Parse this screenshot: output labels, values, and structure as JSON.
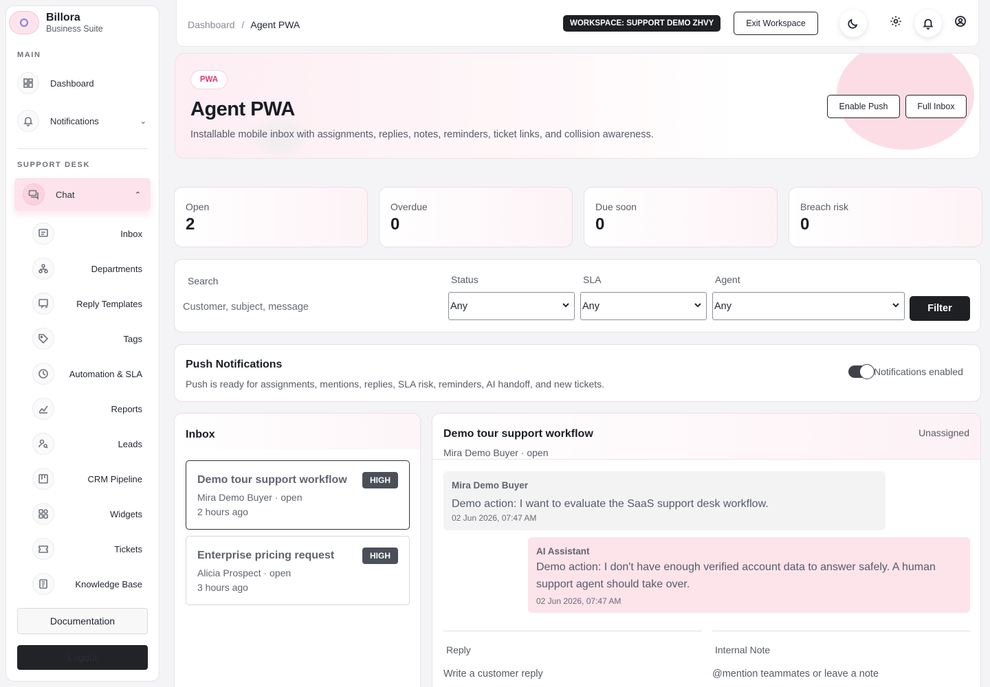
{
  "brand": {
    "name": "Billora",
    "subtitle": "Business Suite"
  },
  "sidebar": {
    "main_label": "MAIN",
    "support_label": "SUPPORT DESK",
    "dashboard": "Dashboard",
    "notifications": "Notifications",
    "chat": "Chat",
    "sub_items": [
      {
        "label": "Inbox",
        "icon": "message-icon"
      },
      {
        "label": "Departments",
        "icon": "org-icon"
      },
      {
        "label": "Reply Templates",
        "icon": "template-icon"
      },
      {
        "label": "Tags",
        "icon": "tag-icon"
      },
      {
        "label": "Automation & SLA",
        "icon": "clock-icon"
      },
      {
        "label": "Reports",
        "icon": "chart-icon"
      },
      {
        "label": "Leads",
        "icon": "user-search-icon"
      },
      {
        "label": "CRM Pipeline",
        "icon": "pipeline-icon"
      },
      {
        "label": "Widgets",
        "icon": "widgets-icon"
      },
      {
        "label": "Tickets",
        "icon": "ticket-icon"
      },
      {
        "label": "Knowledge Base",
        "icon": "book-icon"
      }
    ],
    "documentation": "Documentation",
    "logout": "Logout"
  },
  "topbar": {
    "breadcrumb_root": "Dashboard",
    "breadcrumb_sep": "/",
    "breadcrumb_current": "Agent PWA",
    "workspace_badge": "WORKSPACE: SUPPORT DEMO ZHVY",
    "exit_workspace": "Exit Workspace",
    "icons": [
      "moon-icon",
      "gear-icon",
      "bell-icon",
      "user-circle-icon"
    ]
  },
  "hero": {
    "pill": "PWA",
    "title": "Agent PWA",
    "description": "Installable mobile inbox with assignments, replies, notes, reminders, ticket links, and collision awareness.",
    "enable_push": "Enable Push",
    "full_inbox": "Full Inbox"
  },
  "stats": [
    {
      "label": "Open",
      "value": "2"
    },
    {
      "label": "Overdue",
      "value": "0"
    },
    {
      "label": "Due soon",
      "value": "0"
    },
    {
      "label": "Breach risk",
      "value": "0"
    }
  ],
  "filters": {
    "search_label": "Search",
    "search_placeholder": "Customer, subject, message",
    "status_label": "Status",
    "status_value": "Any",
    "sla_label": "SLA",
    "sla_value": "Any",
    "agent_label": "Agent",
    "agent_value": "Any",
    "filter_button": "Filter"
  },
  "push": {
    "title": "Push Notifications",
    "description": "Push is ready for assignments, mentions, replies, SLA risk, reminders, AI handoff, and new tickets.",
    "toggle_label": "Notifications enabled",
    "enabled": true
  },
  "inbox": {
    "title": "Inbox",
    "conversations": [
      {
        "subject": "Demo tour support workflow",
        "meta": "Mira Demo Buyer · open",
        "time": "2 hours ago",
        "priority": "HIGH",
        "active": true
      },
      {
        "subject": "Enterprise pricing request",
        "meta": "Alicia Prospect · open",
        "time": "3 hours ago",
        "priority": "HIGH",
        "active": false
      }
    ]
  },
  "conversation": {
    "title": "Demo tour support workflow",
    "subtitle": "Mira Demo Buyer · open",
    "assignee": "Unassigned",
    "messages": [
      {
        "author": "Mira Demo Buyer",
        "text": "Demo action: I want to evaluate the SaaS support desk workflow.",
        "timestamp": "02 Jun 2026, 07:47 AM"
      },
      {
        "author": "AI Assistant",
        "text": "Demo action: I don't have enough verified account data to answer safely. A human support agent should take over.",
        "timestamp": "02 Jun 2026, 07:47 AM"
      }
    ],
    "reply_label": "Reply",
    "reply_placeholder": "Write a customer reply",
    "note_label": "Internal Note",
    "note_placeholder": "@mention teammates or leave a note"
  },
  "colors": {
    "accent_pink": "#fde4ec",
    "badge_dark": "#1f2023",
    "priority_badge": "#4a4f5a",
    "pill_text": "#e0396b"
  }
}
